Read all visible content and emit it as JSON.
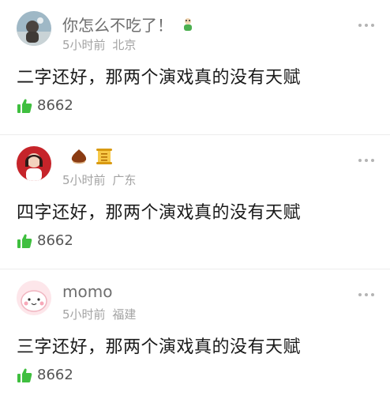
{
  "colors": {
    "like": "#3fbf3f"
  },
  "comments": [
    {
      "name": "你怎么不吃了！",
      "time": "5小时前",
      "location": "北京",
      "text": "二字还好，那两个演戏真的没有天赋",
      "likes": "8662",
      "name_badges": [
        "cartoon-icon"
      ]
    },
    {
      "name": "",
      "time": "5小时前",
      "location": "广东",
      "text": "四字还好，那两个演戏真的没有天赋",
      "likes": "8662",
      "name_badges": [
        "chestnut-icon",
        "scroll-icon"
      ]
    },
    {
      "name": "momo",
      "time": "5小时前",
      "location": "福建",
      "text": "三字还好，那两个演戏真的没有天赋",
      "likes": "8662",
      "name_badges": []
    }
  ]
}
